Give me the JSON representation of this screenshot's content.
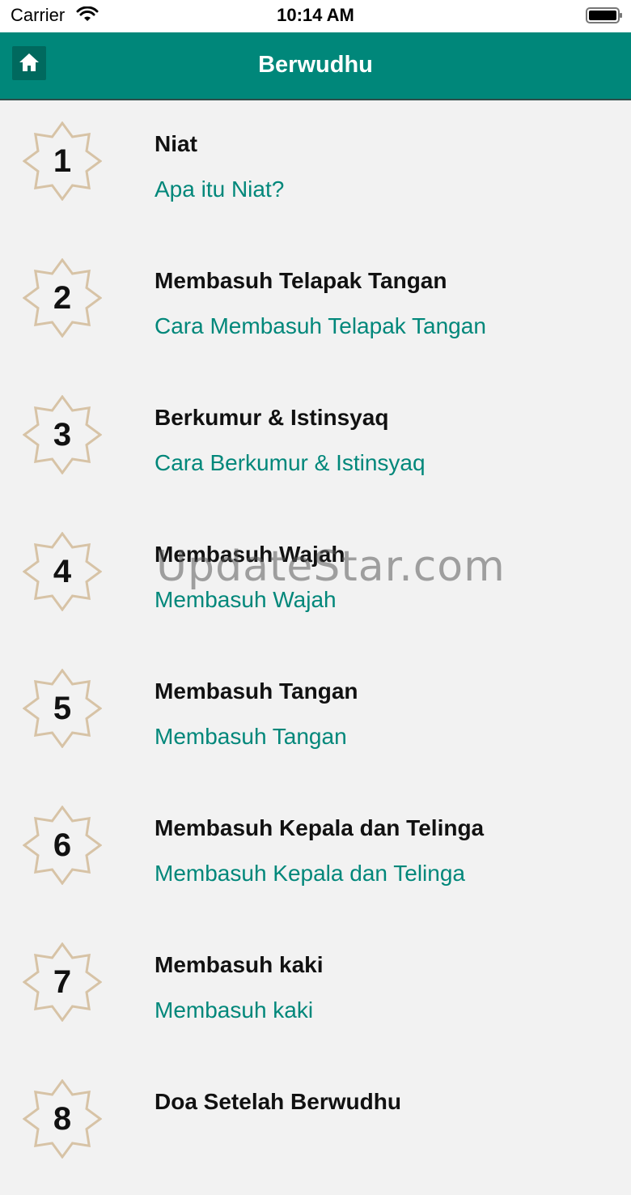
{
  "status_bar": {
    "carrier": "Carrier",
    "time": "10:14 AM"
  },
  "nav": {
    "title": "Berwudhu",
    "home_icon": "home-icon"
  },
  "items": [
    {
      "number": "1",
      "title": "Niat",
      "link": "Apa itu Niat?"
    },
    {
      "number": "2",
      "title": "Membasuh Telapak Tangan",
      "link": "Cara Membasuh Telapak Tangan"
    },
    {
      "number": "3",
      "title": "Berkumur & Istinsyaq",
      "link": "Cara Berkumur & Istinsyaq"
    },
    {
      "number": "4",
      "title": "Membasuh Wajah",
      "link": "Membasuh Wajah"
    },
    {
      "number": "5",
      "title": "Membasuh Tangan",
      "link": "Membasuh Tangan"
    },
    {
      "number": "6",
      "title": "Membasuh Kepala dan Telinga",
      "link": "Membasuh Kepala dan Telinga"
    },
    {
      "number": "7",
      "title": "Membasuh kaki",
      "link": "Membasuh kaki"
    },
    {
      "number": "8",
      "title": "Doa Setelah Berwudhu",
      "link": ""
    }
  ],
  "watermark": "UpdateStar.com",
  "colors": {
    "accent": "#00877a",
    "star_outline": "#d7c3a6"
  }
}
